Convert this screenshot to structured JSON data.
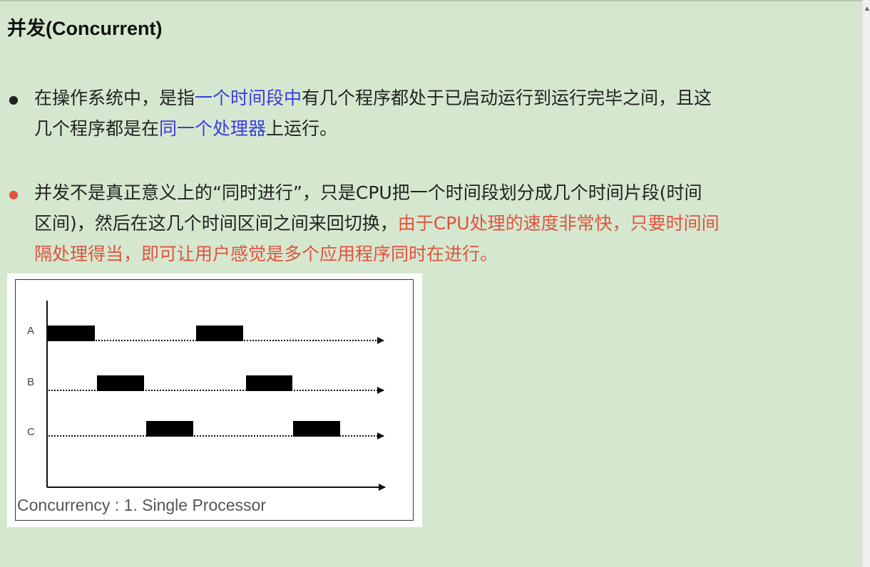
{
  "title": "并发(Concurrent)",
  "bullet1": {
    "part1": "在操作系统中，是指",
    "part2": "一个时间段中",
    "part3": "有几个程序都处于已启动运行到运行完毕之间，且这",
    "part4": "几个程序都是在",
    "part5": "同一个处理器",
    "part6": "上运行。"
  },
  "bullet2": {
    "line1": "并发不是真正意义上的“同时进行”，只是CPU把一个时间段划分成几个时间片段(时间",
    "line2a": "区间)，然后在这几个时间区间之间来回切换，",
    "line2b": "由于CPU处理的速度非常快，只要时间间",
    "line3": "隔处理得当，即可让用户感觉是多个应用程序同时在进行。"
  },
  "figure": {
    "row_labels": [
      "A",
      "B",
      "C"
    ],
    "caption": "Concurrency : 1. Single Processor"
  },
  "colors": {
    "background": "#d5e8cf",
    "highlight_blue": "#3c3ce0",
    "highlight_red": "#e0533f"
  }
}
